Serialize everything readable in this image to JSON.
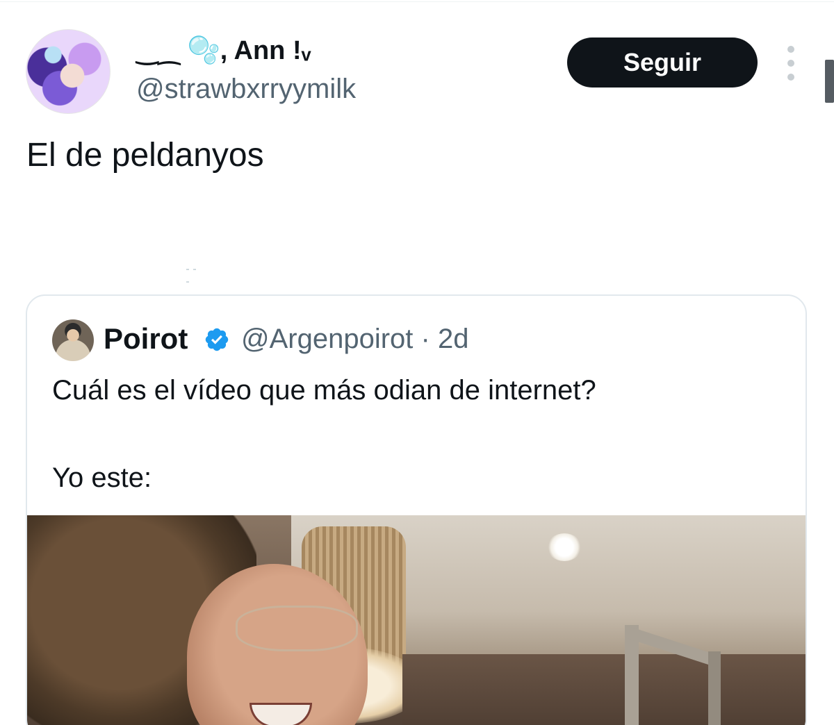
{
  "tweet": {
    "display_name": "‿⁔ 🫧, Ann !ᵥ",
    "handle": "@strawbxrryymilk",
    "follow_label": "Seguir",
    "text": "El de peldanyos"
  },
  "quoted_tweet": {
    "author_name": "Poirot",
    "handle_time": "@Argenpoirot · 2d",
    "text_line_1": "Cuál es el vídeo que más odian de internet?",
    "text_line_2": "Yo este:"
  },
  "colors": {
    "follow_button_bg": "#0f1419",
    "verified_badge": "#1d9bf0",
    "secondary_text": "#536471"
  },
  "icons": {
    "more_options": "more-vertical-icon",
    "verified": "verified-badge-icon"
  }
}
